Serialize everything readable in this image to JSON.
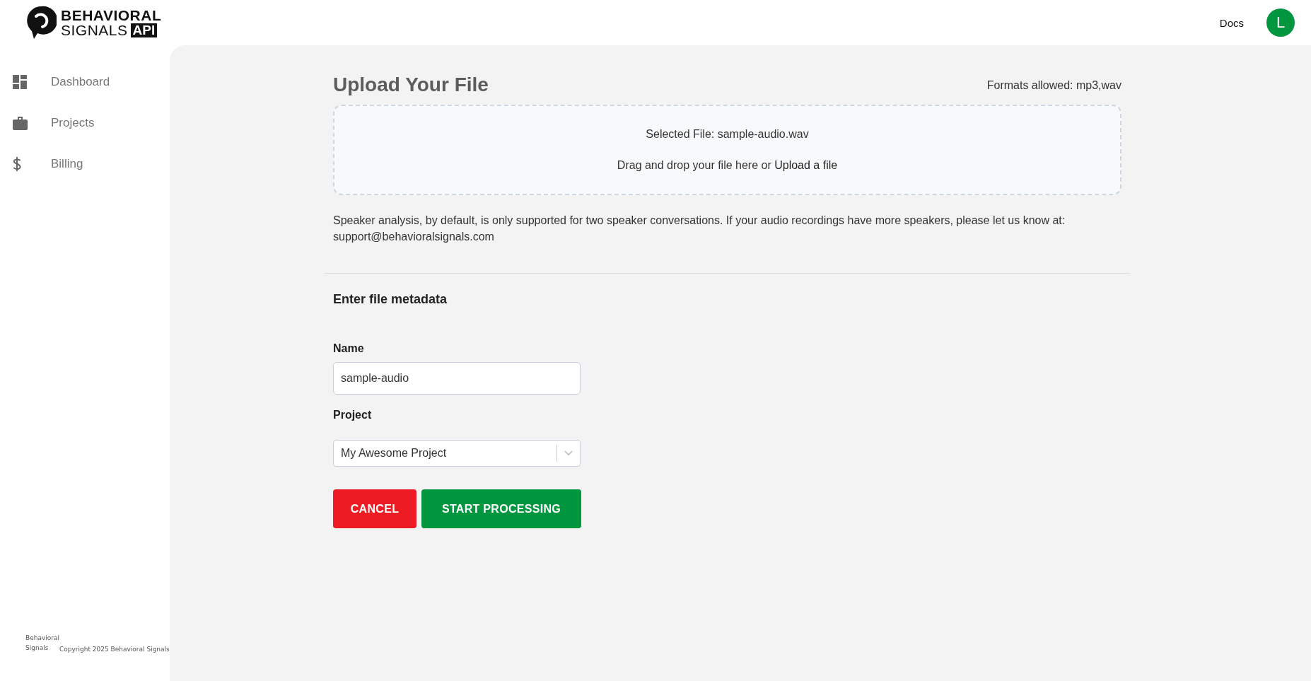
{
  "header": {
    "logo": {
      "line_1": "BEHAVIORAL",
      "line_2": "SIGNALS",
      "badge": "API"
    },
    "docs_link": "Docs",
    "avatar": "L"
  },
  "sidebar": {
    "items": [
      {
        "label": "Dashboard"
      },
      {
        "label": "Projects"
      },
      {
        "label": "Billing"
      }
    ],
    "footer": {
      "brand": "Behavioral Signals",
      "copyright": "Copyright 2025 Behavioral Signals"
    }
  },
  "upload": {
    "title": "Upload Your File",
    "formats": "Formats allowed: mp3,wav",
    "selected_file": "Selected File: sample-audio.wav",
    "drop_prompt": "Drag and drop your file here or",
    "upload_link": "Upload a file",
    "note": "Speaker analysis, by default, is only supported for two speaker conversations. If your audio recordings have more speakers, please let us know at: support@behavioralsignals.com"
  },
  "metadata": {
    "heading": "Enter file metadata",
    "name_label": "Name",
    "name_value": "sample-audio",
    "project_label": "Project",
    "project_value": "My Awesome Project"
  },
  "buttons": {
    "cancel": "CANCEL",
    "start": "START PROCESSING"
  }
}
